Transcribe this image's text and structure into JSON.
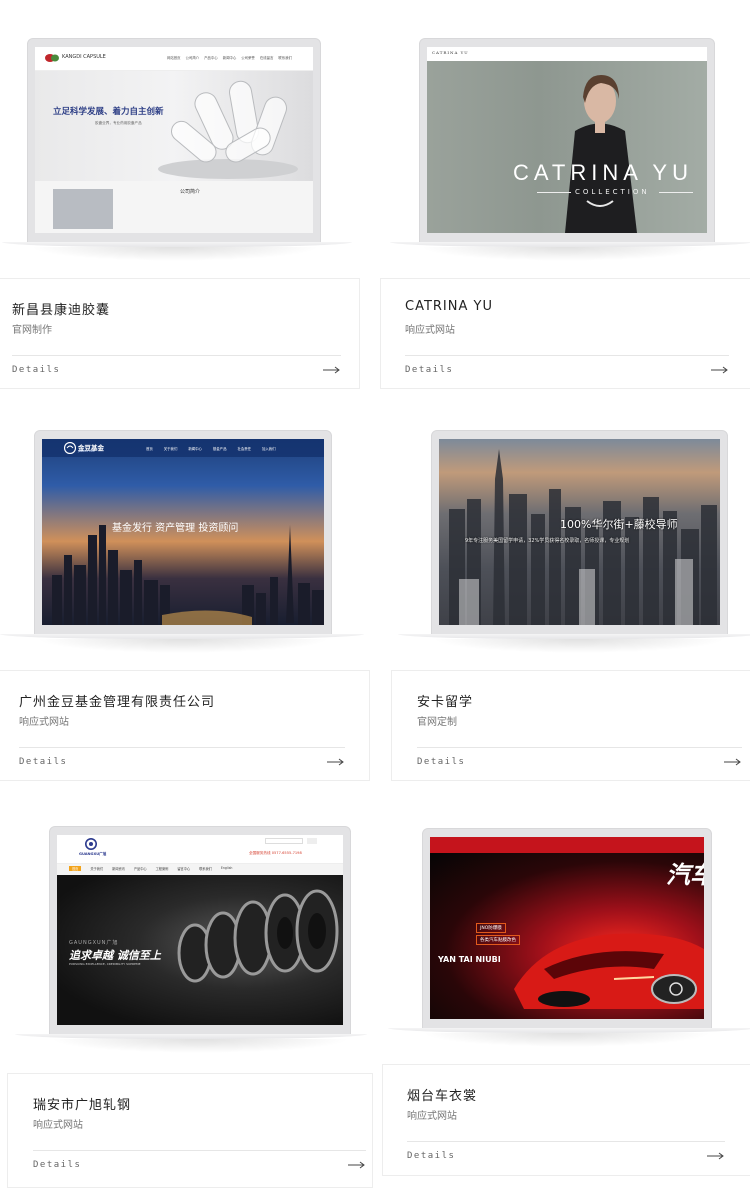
{
  "projects": [
    {
      "title": "新昌县康迪胶囊",
      "subtitle": "官网制作",
      "details_label": "Details",
      "screen": {
        "brand": "KANGDI CAPSULE",
        "slogan": "立足科学发展、着力自主创新",
        "slogan_sub": "胶囊业界，专业药用胶囊产品",
        "section_label": "公司简介",
        "nav": [
          "网站首页",
          "公司简介",
          "产品中心",
          "新闻中心",
          "公司荣誉",
          "在线留言",
          "联系我们"
        ]
      }
    },
    {
      "title": "CATRINA YU",
      "subtitle": "响应式网站",
      "details_label": "Details",
      "screen": {
        "brand": "CATRINA YU",
        "headline": "CATRINA YU",
        "tagline": "COLLECTION"
      }
    },
    {
      "title": "广州金豆基金管理有限责任公司",
      "subtitle": "响应式网站",
      "details_label": "Details",
      "screen": {
        "brand": "金豆基金",
        "brand_en": "JINDOUFUND",
        "headline": "基金发行  资产管理  投资顾问",
        "nav": [
          "首页",
          "关于我们",
          "新闻中心",
          "基金产品",
          "社会责任",
          "加入我们"
        ]
      }
    },
    {
      "title": "安卡留学",
      "subtitle": "官网定制",
      "details_label": "Details",
      "screen": {
        "headline": "100%华尔街+藤校导师",
        "subline": "9年专注服务美国留学申请，32%学员获得名校录取，名师授课，专业规划"
      }
    },
    {
      "title": "瑞安市广旭轧钢",
      "subtitle": "响应式网站",
      "details_label": "Details",
      "screen": {
        "brand": "GUANGXU广旭",
        "hotline": "全国服务热线  0577-6555-7198",
        "headline": "追求卓越  诚信至上",
        "brand_en": "GAUNGXUN广旭",
        "tagline": "PURSUING EXCELLENCE, CREDIBILITY SUPREME",
        "nav": [
          "首页",
          "关于我们",
          "新闻资讯",
          "产品中心",
          "工程案例",
          "留言中心",
          "联系我们",
          "English"
        ]
      }
    },
    {
      "title": "烟台车衣裳",
      "subtitle": "响应式网站",
      "details_label": "Details",
      "screen": {
        "big_text": "汽车",
        "badge1": "JNO防爆膜",
        "badge2": "各类汽车贴膜改色",
        "headline": "YAN TAI NIUBI"
      }
    }
  ],
  "colors": {
    "card_border": "#ededed",
    "laptop_frame": "#e3e3e5",
    "title": "#222222",
    "subtitle": "#777777",
    "kangdi_red": "#c0262b",
    "jindou_blue": "#1d3f7a",
    "guangxu_orange": "#f2a31b",
    "yantai_red": "#c5141c"
  }
}
